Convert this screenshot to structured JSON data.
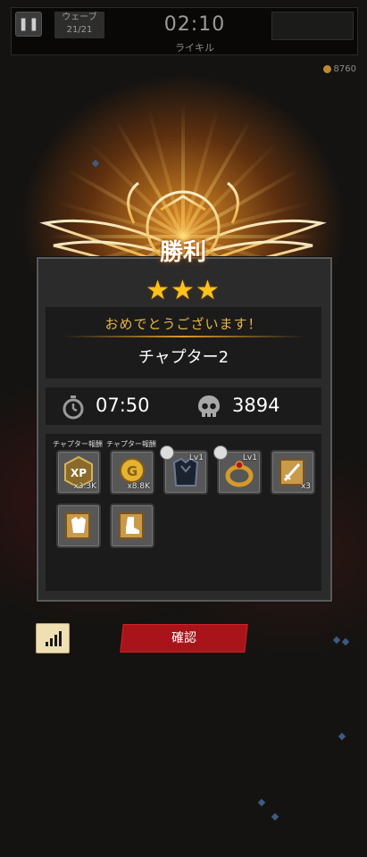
{
  "hud": {
    "pause_icon": "pause-icon",
    "wave_label": "ウェーブ",
    "wave_value": "21/21",
    "timer": "02:10",
    "stage_name": "ライキル",
    "coins": "8760"
  },
  "result": {
    "title": "勝利",
    "stars": "★★★",
    "congrats": "おめでとうございます！",
    "chapter": "チャプター2",
    "time": "07:50",
    "kills": "3894"
  },
  "rewards": {
    "label_1": "チャプター報酬",
    "label_2": "チャプター報酬",
    "items": [
      {
        "icon": "xp-icon",
        "count": "x3.3K"
      },
      {
        "icon": "gold-coin-icon",
        "count": "x8.8K"
      },
      {
        "icon": "dark-armor-icon",
        "level": "Lv1"
      },
      {
        "icon": "ring-icon",
        "level": "Lv1"
      },
      {
        "icon": "sword-scroll-icon",
        "count": "x3"
      },
      {
        "icon": "armor-scroll-icon"
      },
      {
        "icon": "boots-scroll-icon"
      }
    ]
  },
  "buttons": {
    "confirm": "確認",
    "rank_icon": "signal-bars-icon"
  },
  "colors": {
    "accent_gold": "#e8b548",
    "star": "#ffc21a",
    "confirm_red": "#a8141a"
  }
}
